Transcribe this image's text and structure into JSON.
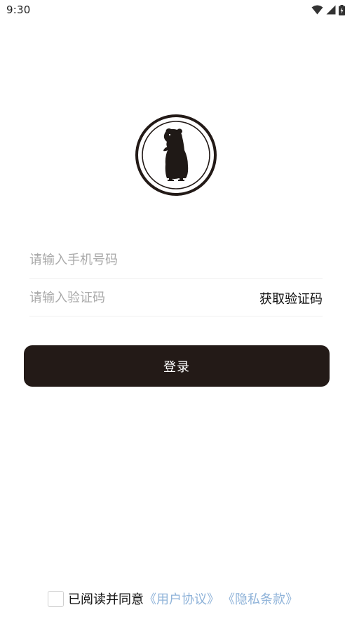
{
  "status_bar": {
    "time": "9:30",
    "icons": [
      "wifi-icon",
      "cell-signal-icon",
      "battery-charging-icon"
    ]
  },
  "logo": {
    "icon": "hamster-logo-icon"
  },
  "form": {
    "phone_placeholder": "请输入手机号码",
    "phone_value": "",
    "code_placeholder": "请输入验证码",
    "code_value": "",
    "get_code_label": "获取验证码"
  },
  "login_button": {
    "label": "登录"
  },
  "agreement": {
    "checked": false,
    "text": "已阅读并同意",
    "user_agreement": "《用户协议》",
    "privacy_policy": "《隐私条款》"
  },
  "colors": {
    "button_bg": "#231a17",
    "link": "#8fb3d9",
    "placeholder": "#a9a9a9"
  }
}
